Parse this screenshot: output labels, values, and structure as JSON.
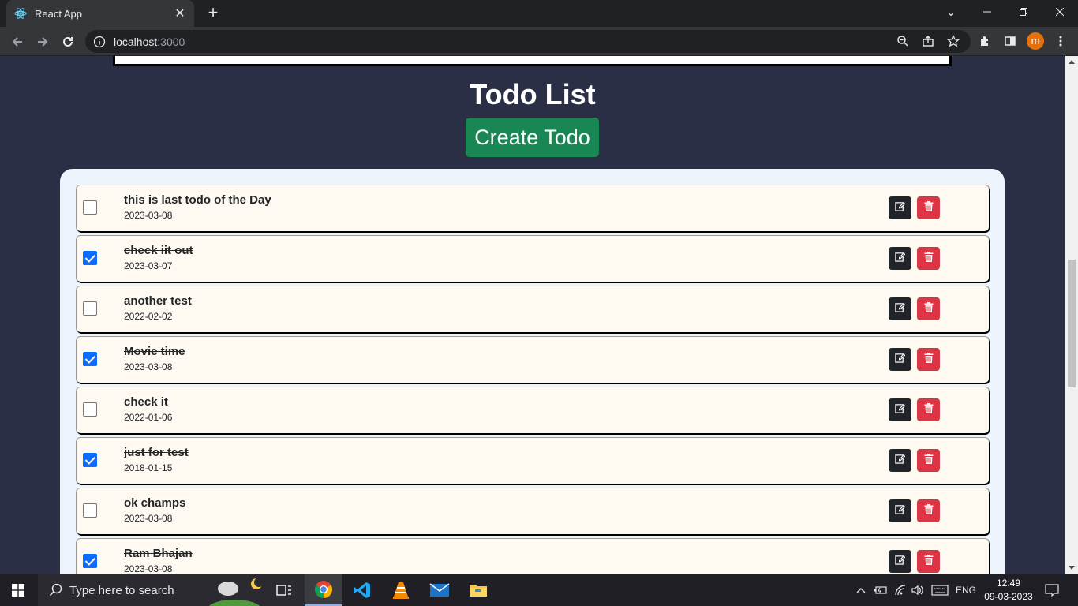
{
  "browser": {
    "tab_title": "React App",
    "url_host": "localhost",
    "url_port": ":3000",
    "profile_initial": "m"
  },
  "page": {
    "title": "Todo List",
    "create_button": "Create Todo"
  },
  "todos": [
    {
      "title": "this is last todo of the Day",
      "date": "2023-03-08",
      "completed": false
    },
    {
      "title": "check iit out",
      "date": "2023-03-07",
      "completed": true
    },
    {
      "title": "another test",
      "date": "2022-02-02",
      "completed": false
    },
    {
      "title": "Movie time",
      "date": "2023-03-08",
      "completed": true
    },
    {
      "title": "check it",
      "date": "2022-01-06",
      "completed": false
    },
    {
      "title": "just for test",
      "date": "2018-01-15",
      "completed": true
    },
    {
      "title": "ok champs",
      "date": "2023-03-08",
      "completed": false
    },
    {
      "title": "Ram Bhajan",
      "date": "2023-03-08",
      "completed": true
    }
  ],
  "taskbar": {
    "search_placeholder": "Type here to search",
    "language": "ENG",
    "time": "12:49",
    "date": "09-03-2023"
  },
  "colors": {
    "page_bg": "#2b2f45",
    "create_button": "#198754",
    "checkbox_checked": "#0d6efd",
    "edit_button": "#212529",
    "delete_button": "#dc3545"
  }
}
